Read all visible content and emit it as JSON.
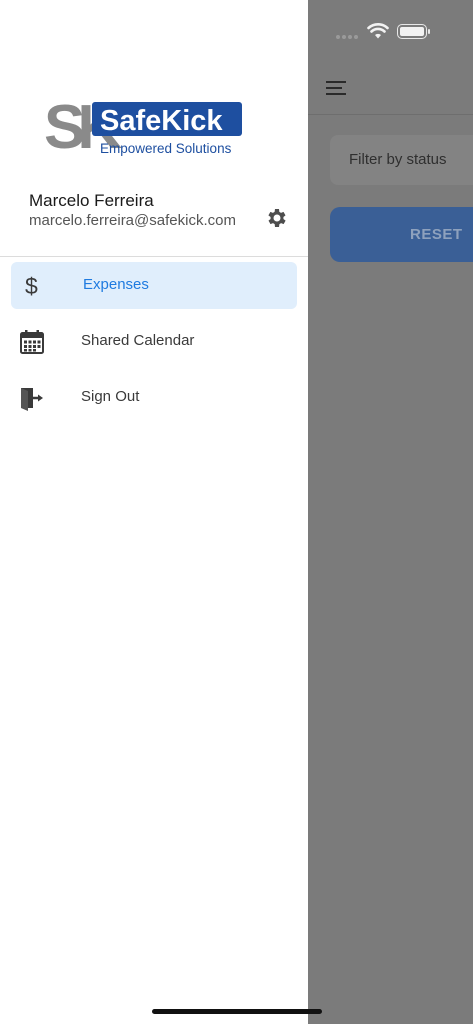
{
  "background_app": {
    "filter_placeholder": "Filter by status",
    "reset_label": "RESET"
  },
  "drawer": {
    "logo": {
      "mark": "SK",
      "brand": "SafeKick",
      "tagline": "Empowered Solutions"
    },
    "user": {
      "name": "Marcelo Ferreira",
      "email": "marcelo.ferreira@safekick.com"
    },
    "menu": [
      {
        "label": "Expenses",
        "icon": "dollar-icon",
        "active": true
      },
      {
        "label": "Shared Calendar",
        "icon": "calendar-icon",
        "active": false
      },
      {
        "label": "Sign Out",
        "icon": "sign-out-icon",
        "active": false
      }
    ]
  },
  "colors": {
    "active_bg": "#e0eefc",
    "active_text": "#1f7be0",
    "brand_blue": "#1e4fa0",
    "reset_button": "#3a5f96"
  }
}
